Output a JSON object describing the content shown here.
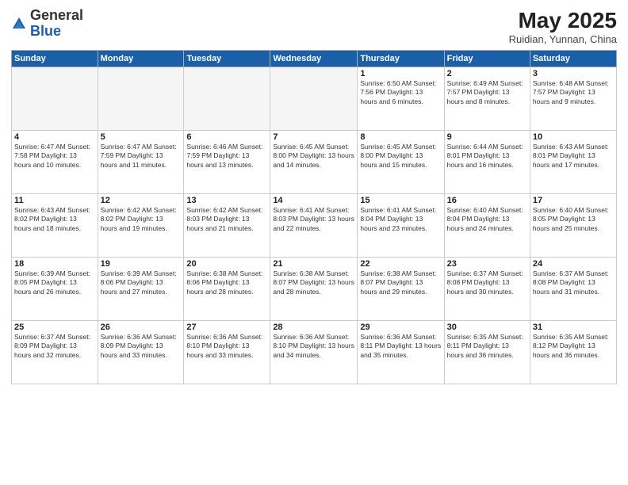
{
  "logo": {
    "general": "General",
    "blue": "Blue"
  },
  "title": "May 2025",
  "subtitle": "Ruidian, Yunnan, China",
  "days_of_week": [
    "Sunday",
    "Monday",
    "Tuesday",
    "Wednesday",
    "Thursday",
    "Friday",
    "Saturday"
  ],
  "weeks": [
    [
      {
        "day": "",
        "info": ""
      },
      {
        "day": "",
        "info": ""
      },
      {
        "day": "",
        "info": ""
      },
      {
        "day": "",
        "info": ""
      },
      {
        "day": "1",
        "info": "Sunrise: 6:50 AM\nSunset: 7:56 PM\nDaylight: 13 hours\nand 6 minutes."
      },
      {
        "day": "2",
        "info": "Sunrise: 6:49 AM\nSunset: 7:57 PM\nDaylight: 13 hours\nand 8 minutes."
      },
      {
        "day": "3",
        "info": "Sunrise: 6:48 AM\nSunset: 7:57 PM\nDaylight: 13 hours\nand 9 minutes."
      }
    ],
    [
      {
        "day": "4",
        "info": "Sunrise: 6:47 AM\nSunset: 7:58 PM\nDaylight: 13 hours\nand 10 minutes."
      },
      {
        "day": "5",
        "info": "Sunrise: 6:47 AM\nSunset: 7:59 PM\nDaylight: 13 hours\nand 11 minutes."
      },
      {
        "day": "6",
        "info": "Sunrise: 6:46 AM\nSunset: 7:59 PM\nDaylight: 13 hours\nand 13 minutes."
      },
      {
        "day": "7",
        "info": "Sunrise: 6:45 AM\nSunset: 8:00 PM\nDaylight: 13 hours\nand 14 minutes."
      },
      {
        "day": "8",
        "info": "Sunrise: 6:45 AM\nSunset: 8:00 PM\nDaylight: 13 hours\nand 15 minutes."
      },
      {
        "day": "9",
        "info": "Sunrise: 6:44 AM\nSunset: 8:01 PM\nDaylight: 13 hours\nand 16 minutes."
      },
      {
        "day": "10",
        "info": "Sunrise: 6:43 AM\nSunset: 8:01 PM\nDaylight: 13 hours\nand 17 minutes."
      }
    ],
    [
      {
        "day": "11",
        "info": "Sunrise: 6:43 AM\nSunset: 8:02 PM\nDaylight: 13 hours\nand 18 minutes."
      },
      {
        "day": "12",
        "info": "Sunrise: 6:42 AM\nSunset: 8:02 PM\nDaylight: 13 hours\nand 19 minutes."
      },
      {
        "day": "13",
        "info": "Sunrise: 6:42 AM\nSunset: 8:03 PM\nDaylight: 13 hours\nand 21 minutes."
      },
      {
        "day": "14",
        "info": "Sunrise: 6:41 AM\nSunset: 8:03 PM\nDaylight: 13 hours\nand 22 minutes."
      },
      {
        "day": "15",
        "info": "Sunrise: 6:41 AM\nSunset: 8:04 PM\nDaylight: 13 hours\nand 23 minutes."
      },
      {
        "day": "16",
        "info": "Sunrise: 6:40 AM\nSunset: 8:04 PM\nDaylight: 13 hours\nand 24 minutes."
      },
      {
        "day": "17",
        "info": "Sunrise: 6:40 AM\nSunset: 8:05 PM\nDaylight: 13 hours\nand 25 minutes."
      }
    ],
    [
      {
        "day": "18",
        "info": "Sunrise: 6:39 AM\nSunset: 8:05 PM\nDaylight: 13 hours\nand 26 minutes."
      },
      {
        "day": "19",
        "info": "Sunrise: 6:39 AM\nSunset: 8:06 PM\nDaylight: 13 hours\nand 27 minutes."
      },
      {
        "day": "20",
        "info": "Sunrise: 6:38 AM\nSunset: 8:06 PM\nDaylight: 13 hours\nand 28 minutes."
      },
      {
        "day": "21",
        "info": "Sunrise: 6:38 AM\nSunset: 8:07 PM\nDaylight: 13 hours\nand 28 minutes."
      },
      {
        "day": "22",
        "info": "Sunrise: 6:38 AM\nSunset: 8:07 PM\nDaylight: 13 hours\nand 29 minutes."
      },
      {
        "day": "23",
        "info": "Sunrise: 6:37 AM\nSunset: 8:08 PM\nDaylight: 13 hours\nand 30 minutes."
      },
      {
        "day": "24",
        "info": "Sunrise: 6:37 AM\nSunset: 8:08 PM\nDaylight: 13 hours\nand 31 minutes."
      }
    ],
    [
      {
        "day": "25",
        "info": "Sunrise: 6:37 AM\nSunset: 8:09 PM\nDaylight: 13 hours\nand 32 minutes."
      },
      {
        "day": "26",
        "info": "Sunrise: 6:36 AM\nSunset: 8:09 PM\nDaylight: 13 hours\nand 33 minutes."
      },
      {
        "day": "27",
        "info": "Sunrise: 6:36 AM\nSunset: 8:10 PM\nDaylight: 13 hours\nand 33 minutes."
      },
      {
        "day": "28",
        "info": "Sunrise: 6:36 AM\nSunset: 8:10 PM\nDaylight: 13 hours\nand 34 minutes."
      },
      {
        "day": "29",
        "info": "Sunrise: 6:36 AM\nSunset: 8:11 PM\nDaylight: 13 hours\nand 35 minutes."
      },
      {
        "day": "30",
        "info": "Sunrise: 6:35 AM\nSunset: 8:11 PM\nDaylight: 13 hours\nand 36 minutes."
      },
      {
        "day": "31",
        "info": "Sunrise: 6:35 AM\nSunset: 8:12 PM\nDaylight: 13 hours\nand 36 minutes."
      }
    ]
  ]
}
